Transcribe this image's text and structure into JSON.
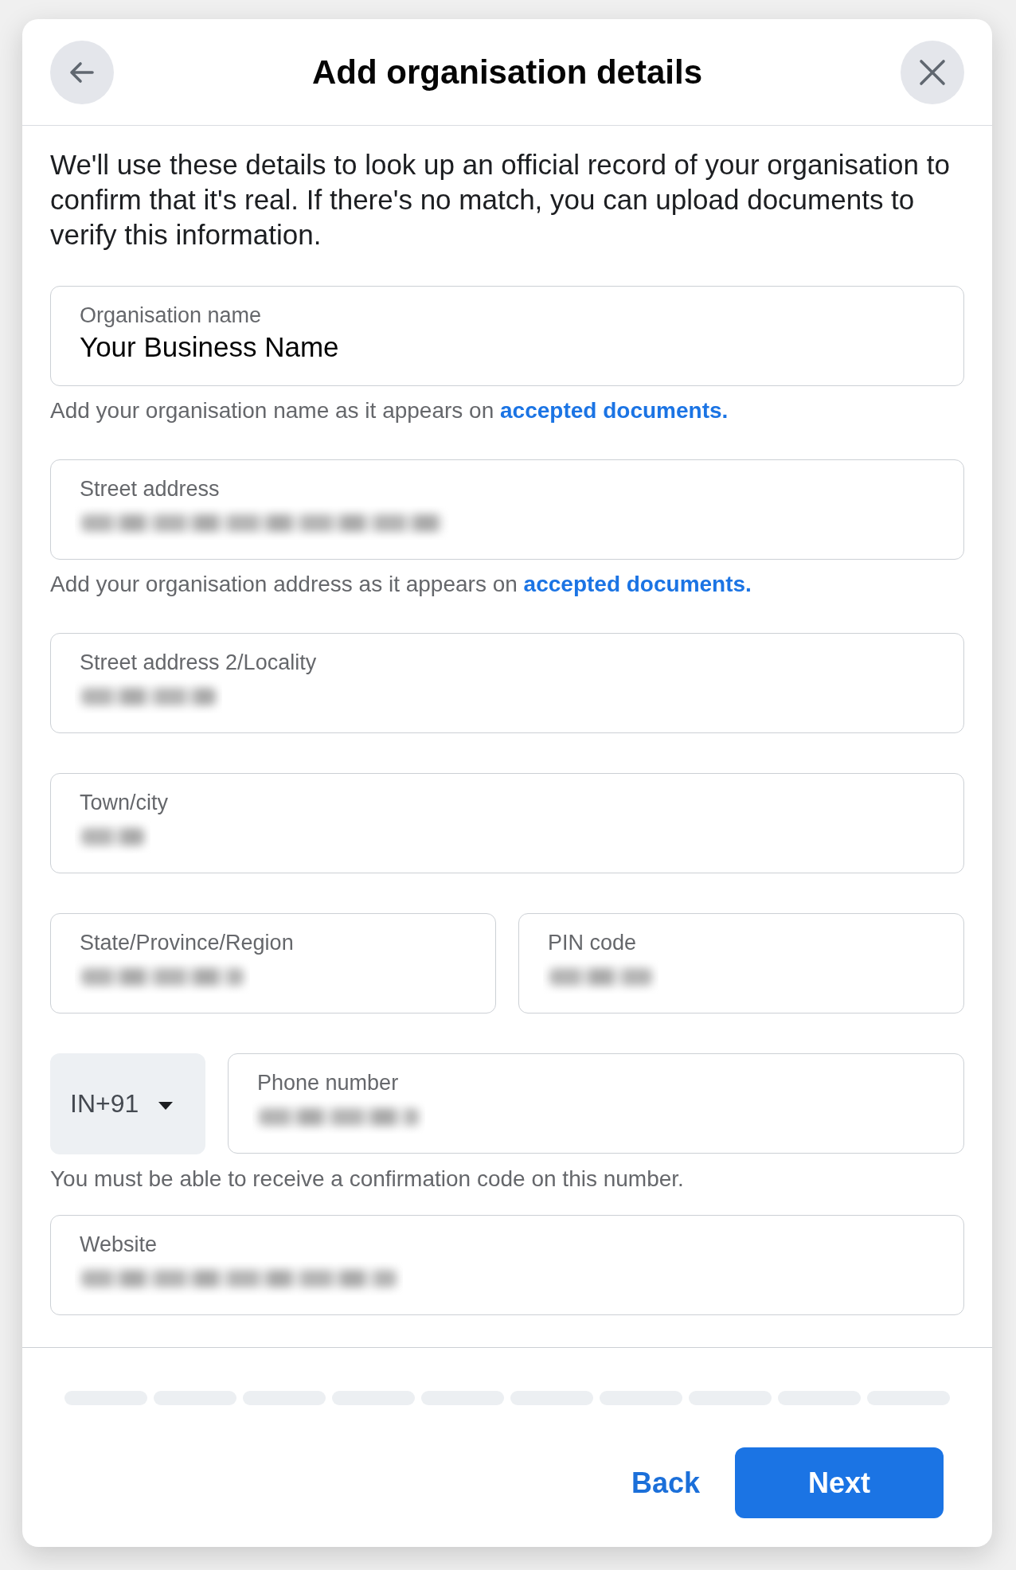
{
  "dialog": {
    "title": "Add organisation details",
    "description": "We'll use these details to look up an official record of your organisation to confirm that it's real. If there's no match, you can upload documents to verify this information."
  },
  "rows": [
    {
      "fields": [
        {
          "kind": "text",
          "label": "Organisation name",
          "value": "Your Business Name",
          "blurred": false
        }
      ],
      "helper": {
        "text": "Add your organisation name as it appears on",
        "link": "accepted documents."
      }
    },
    {
      "fields": [
        {
          "kind": "text",
          "label": "Street address",
          "blurred": true
        }
      ],
      "helper": {
        "text": "Add your organisation address as it appears on",
        "link": "accepted documents."
      }
    },
    {
      "fields": [
        {
          "kind": "text",
          "label": "Street address 2/Locality",
          "blurred": true
        }
      ]
    },
    {
      "fields": [
        {
          "kind": "text",
          "label": "Town/city",
          "blurred": true
        }
      ]
    },
    {
      "fields": [
        {
          "kind": "text",
          "label": "State/Province/Region",
          "blurred": true
        },
        {
          "kind": "text",
          "label": "PIN code",
          "blurred": true
        }
      ]
    },
    {
      "fields": [
        {
          "kind": "select",
          "value": "IN+91"
        },
        {
          "kind": "text",
          "label": "Phone number",
          "blurred": true
        }
      ],
      "helper": {
        "text": "You must be able to receive a confirmation code on this number."
      }
    },
    {
      "fields": [
        {
          "kind": "text",
          "label": "Website",
          "blurred": true
        }
      ]
    }
  ],
  "progress": [
    {
      "completed": false
    },
    {
      "completed": false
    },
    {
      "completed": false
    },
    {
      "completed": false
    },
    {
      "completed": false
    },
    {
      "completed": false
    },
    {
      "completed": false
    },
    {
      "completed": false
    },
    {
      "completed": false
    },
    {
      "completed": false
    }
  ],
  "buttons": [
    {
      "kind": "text",
      "label": "Back"
    },
    {
      "kind": "primary",
      "label": "Next"
    }
  ]
}
